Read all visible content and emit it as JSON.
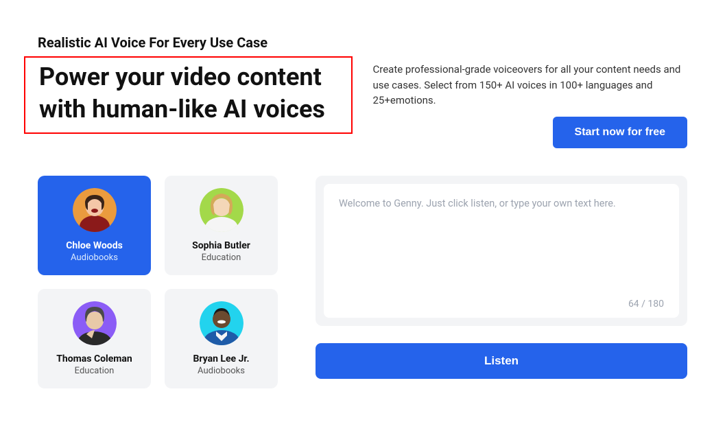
{
  "header": {
    "eyebrow": "Realistic AI Voice For Every Use Case",
    "headline": "Power your video content with human-like AI voices",
    "description": "Create professional-grade voiceovers for all your content needs and use cases. Select from 150+ AI voices in 100+ languages and 25+emotions.",
    "start_button": "Start now for free"
  },
  "voices": [
    {
      "name": "Chloe Woods",
      "category": "Audiobooks",
      "active": true,
      "bg": "#ea9b3e"
    },
    {
      "name": "Sophia Butler",
      "category": "Education",
      "active": false,
      "bg": "#a3d94a"
    },
    {
      "name": "Thomas Coleman",
      "category": "Education",
      "active": false,
      "bg": "#8b5cf6"
    },
    {
      "name": "Bryan Lee Jr.",
      "category": "Audiobooks",
      "active": false,
      "bg": "#22d3ee"
    }
  ],
  "input": {
    "placeholder": "Welcome to Genny. Just click listen, or type your own text here.",
    "char_count": "64 / 180",
    "listen_button": "Listen"
  }
}
